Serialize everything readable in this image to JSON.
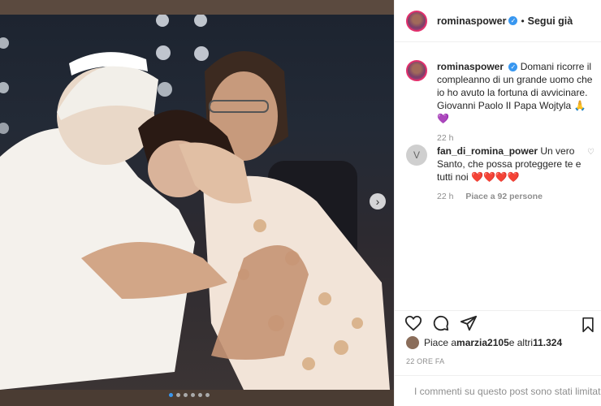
{
  "account": {
    "username": "rominaspower",
    "follow_status": "Segui già"
  },
  "caption": {
    "username": "rominaspower",
    "text": "Domani ricorre il compleanno di un grande uomo che io ho avuto la fortuna di avvicinare. Giovanni Paolo II Papa Wojtyla 🙏💜",
    "time": "22 h"
  },
  "comments": [
    {
      "username": "fan_di_romina_power",
      "text": "Un vero Santo, che possa proteggere te e tutti noi ❤️❤️❤️❤️",
      "time": "22 h",
      "likes": "Piace a 92 persone"
    }
  ],
  "likes": {
    "prefix": "Piace a ",
    "user": "marzia2105",
    "middle": " e altri ",
    "count": "11.324"
  },
  "post_time": "22 ORE FA",
  "comment_notice": "I commenti su questo post sono stati limitati.",
  "icons": {
    "like": "heart-icon",
    "comment": "comment-icon",
    "share": "share-icon",
    "save": "bookmark-icon"
  },
  "colors": {
    "verified": "#3897f0",
    "heart": "#ed4956"
  },
  "carousel": {
    "count": 6,
    "active": 0
  }
}
